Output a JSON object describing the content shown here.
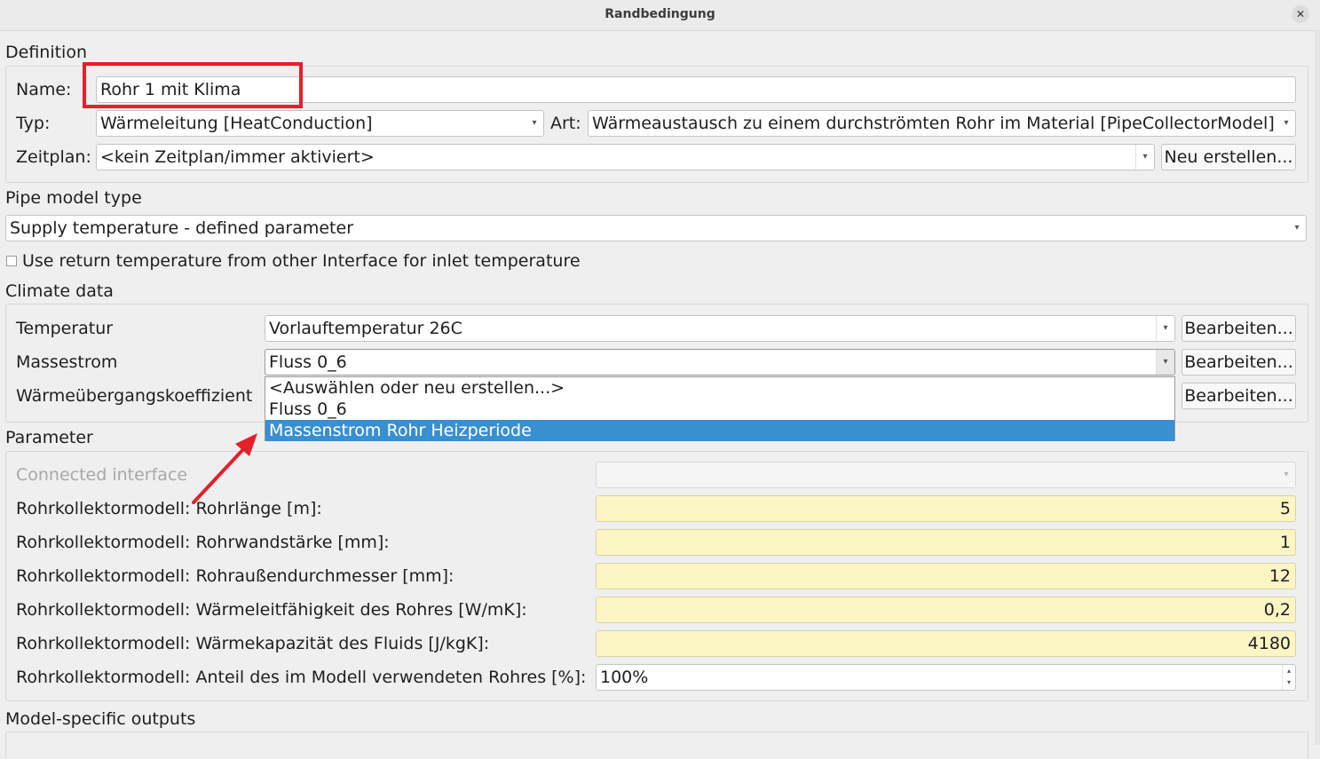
{
  "window": {
    "title": "Randbedingung",
    "close_glyph": "✕"
  },
  "definition": {
    "heading": "Definition",
    "name_label": "Name:",
    "name_value": "Rohr 1 mit Klima",
    "typ_label": "Typ:",
    "typ_value": "Wärmeleitung [HeatConduction]",
    "art_label": "Art:",
    "art_value": "Wärmeaustausch zu einem durchströmten Rohr im Material [PipeCollectorModel]",
    "zeitplan_label": "Zeitplan:",
    "zeitplan_value": "<kein Zeitplan/immer aktiviert>",
    "neu_button": "Neu erstellen..."
  },
  "pipe_model": {
    "heading": "Pipe model type",
    "value": "Supply temperature - defined parameter",
    "checkbox_label": "Use return temperature from other Interface for inlet temperature"
  },
  "climate": {
    "heading": "Climate data",
    "rows": [
      {
        "label": "Temperatur",
        "value": "Vorlauftemperatur 26C",
        "button": "Bearbeiten..."
      },
      {
        "label": "Massestrom",
        "value": "Fluss 0_6",
        "button": "Bearbeiten..."
      },
      {
        "label": "Wärmeübergangskoeffizient",
        "value": "",
        "button": "Bearbeiten..."
      }
    ],
    "dropdown_options": [
      "<Auswählen oder neu erstellen...>",
      "Fluss 0_6",
      "Massenstrom Rohr Heizperiode"
    ],
    "selected_option_index": 2
  },
  "parameter": {
    "heading": "Parameter",
    "connected_interface_label": "Connected interface",
    "rows": [
      {
        "label": "Rohrkollektormodell: Rohrlänge [m]:",
        "value": "5"
      },
      {
        "label": "Rohrkollektormodell: Rohrwandstärke [mm]:",
        "value": "1"
      },
      {
        "label": "Rohrkollektormodell: Rohraußendurchmesser [mm]:",
        "value": "12"
      },
      {
        "label": "Rohrkollektormodell: Wärmeleitfähigkeit des Rohres [W/mK]:",
        "value": "0,2"
      },
      {
        "label": "Rohrkollektormodell: Wärmekapazität des Fluids [J/kgK]:",
        "value": "4180"
      }
    ],
    "anteil_label": "Rohrkollektormodell: Anteil des im Modell verwendeten Rohres [%]:",
    "anteil_value": "100%"
  },
  "outputs": {
    "heading": "Model-specific outputs"
  },
  "colors": {
    "highlight": "#3a8fd0",
    "annotation_red": "#e3202c",
    "editable_field": "#fcf5c4"
  }
}
